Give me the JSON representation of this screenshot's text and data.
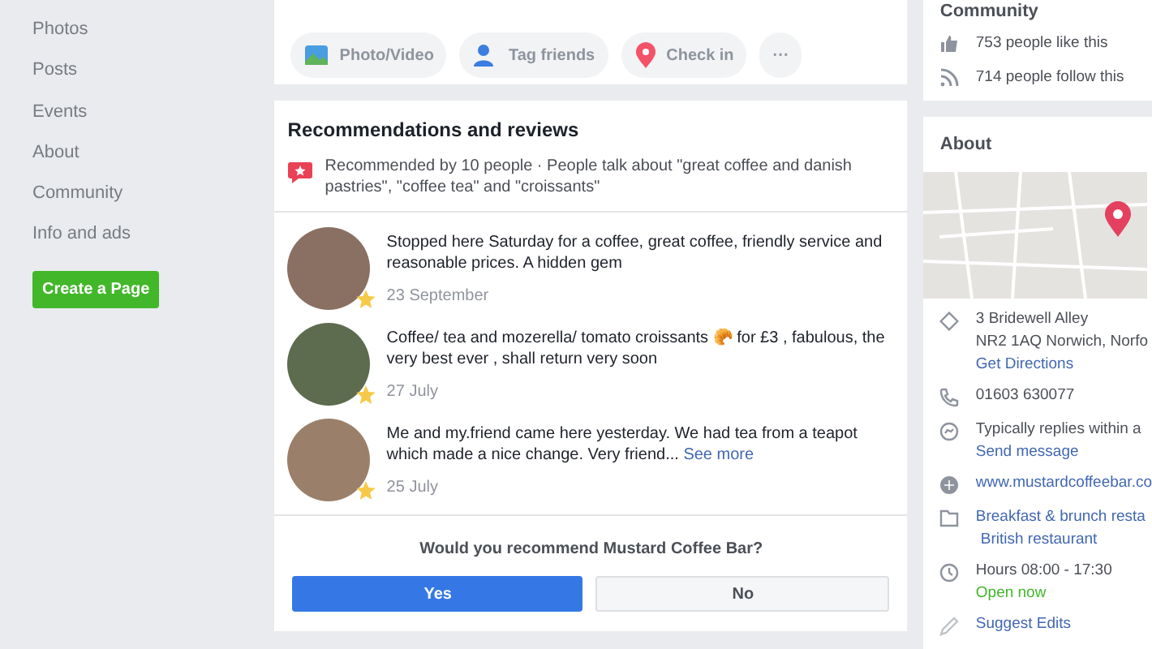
{
  "sidebar": {
    "items": [
      {
        "label": "Photos"
      },
      {
        "label": "Posts"
      },
      {
        "label": "Events"
      },
      {
        "label": "About"
      },
      {
        "label": "Community"
      },
      {
        "label": "Info and ads"
      }
    ],
    "create_button": "Create a Page"
  },
  "composer": {
    "actions": [
      {
        "kind": "photo",
        "label": "Photo/Video"
      },
      {
        "kind": "tag",
        "label": "Tag friends"
      },
      {
        "kind": "checkin",
        "label": "Check in"
      },
      {
        "kind": "more",
        "label": "···"
      }
    ]
  },
  "recommendations": {
    "title": "Recommendations and reviews",
    "summary": "Recommended by 10 people · People talk about \"great coffee and danish pastries\", \"coffee tea\" and \"croissants\"",
    "reviews": [
      {
        "text": "Stopped here Saturday for a coffee, great coffee, friendly service and reasonable prices. A hidden gem",
        "date": "23 September"
      },
      {
        "text": "Coffee/ tea and mozerella/ tomato croissants 🥐 for £3 , fabulous, the very best ever , shall return very soon",
        "date": "27 July"
      },
      {
        "text": "Me and my.friend came here yesterday. We had tea from a teapot which made a nice change. Very friend...",
        "see_more": "See more",
        "date": "25 July"
      }
    ],
    "question": "Would you recommend Mustard Coffee Bar?",
    "answers": [
      {
        "label": "Yes",
        "selected": true
      },
      {
        "label": "No",
        "selected": false
      }
    ]
  },
  "community": {
    "title": "Community",
    "items": [
      {
        "kind": "like",
        "text": "753 people like this"
      },
      {
        "kind": "follow",
        "text": "714 people follow this"
      }
    ]
  },
  "about": {
    "title": "About",
    "items": [
      {
        "kind": "address",
        "lines": [
          "3 Bridewell Alley",
          "NR2 1AQ Norwich, Norfo"
        ],
        "link": "Get Directions"
      },
      {
        "kind": "phone",
        "lines": [
          "01603 630077"
        ]
      },
      {
        "kind": "message",
        "lines": [
          "Typically replies within a"
        ],
        "link": "Send message"
      },
      {
        "kind": "web",
        "link": "www.mustardcoffeebar.co"
      },
      {
        "kind": "category",
        "link": "Breakfast & brunch resta",
        "sub": "British restaurant"
      },
      {
        "kind": "hours",
        "lines": [
          "Hours 08:00 - 17:30"
        ],
        "status": "Open now"
      },
      {
        "kind": "edit",
        "link": "Suggest Edits"
      }
    ]
  }
}
